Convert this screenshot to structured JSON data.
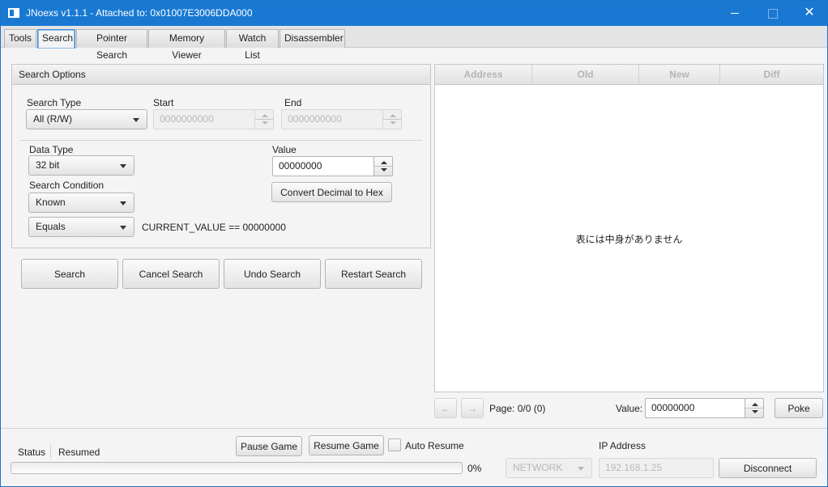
{
  "window": {
    "title": "JNoexs v1.1.1 - Attached to: 0x01007E3006DDA000",
    "close_glyph": "✕"
  },
  "tabs": [
    {
      "label": "Tools"
    },
    {
      "label": "Search"
    },
    {
      "label": "Pointer Search"
    },
    {
      "label": "Memory Viewer"
    },
    {
      "label": "Watch List"
    },
    {
      "label": "Disassembler"
    }
  ],
  "active_tab": "Search",
  "search_options": {
    "title": "Search Options",
    "search_type_label": "Search Type",
    "search_type_value": "All (R/W)",
    "start_label": "Start",
    "start_value": "0000000000",
    "end_label": "End",
    "end_value": "0000000000",
    "data_type_label": "Data Type",
    "data_type_value": "32 bit",
    "value_label": "Value",
    "value_value": "00000000",
    "search_condition_label": "Search Condition",
    "search_condition_value": "Known",
    "compare_value": "Equals",
    "condition_expression": "CURRENT_VALUE == 00000000",
    "convert_button": "Convert Decimal to Hex"
  },
  "actions": {
    "search": "Search",
    "cancel": "Cancel Search",
    "undo": "Undo Search",
    "restart": "Restart Search"
  },
  "results_table": {
    "columns": [
      "Address",
      "Old",
      "New",
      "Diff"
    ],
    "empty_message": "表には中身がありません"
  },
  "pager": {
    "prev_glyph": "←",
    "next_glyph": "→",
    "page_text": "Page: 0/0 (0)",
    "value_label": "Value:",
    "value_value": "00000000",
    "poke_button": "Poke"
  },
  "status": {
    "label": "Status",
    "value": "Resumed",
    "progress_percent": "0%",
    "progress_fraction": 0,
    "pause_button": "Pause Game",
    "resume_button": "Resume Game",
    "auto_resume_label": "Auto Resume",
    "auto_resume_checked": false,
    "ip_label": "IP Address",
    "connection_type": "NETWORK",
    "ip_value": "192.168.1.25",
    "disconnect_button": "Disconnect"
  },
  "colors": {
    "titlebar": "#1979d2",
    "accent": "#3b8bd8"
  }
}
